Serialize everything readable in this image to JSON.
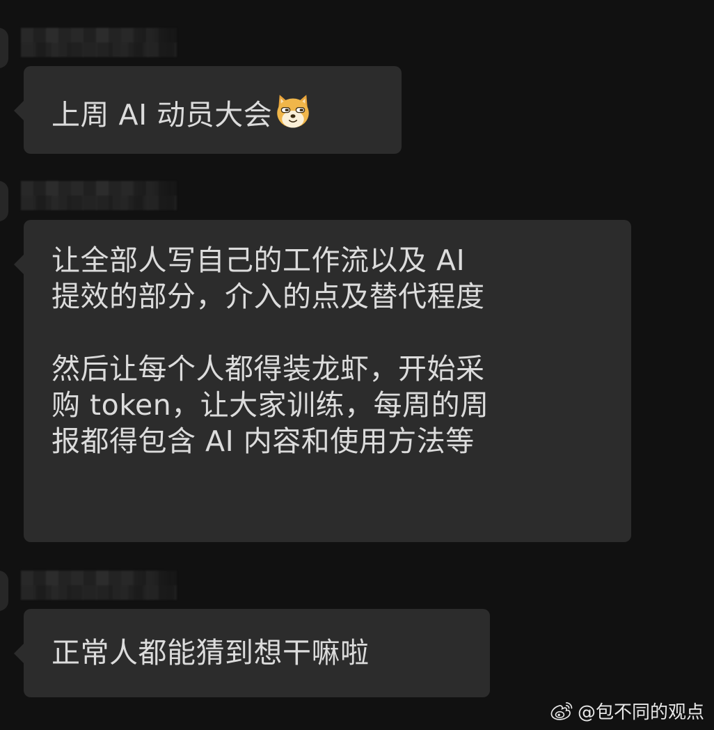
{
  "messages": [
    {
      "sender_name": "",
      "lines": [
        "上周 AI 动员大会"
      ],
      "emoji": "doge-emoji"
    },
    {
      "sender_name": "",
      "paragraphs": [
        [
          "让全部人写自己的工作流以及 AI",
          "提效的部分，介入的点及替代程度"
        ],
        [
          "然后让每个人都得装龙虾，开始采",
          "购 token，让大家训练，每周的周",
          "报都得包含 AI 内容和使用方法等"
        ]
      ]
    },
    {
      "sender_name": "",
      "lines": [
        "正常人都能猜到想干嘛啦"
      ]
    }
  ],
  "watermark": {
    "icon": "weibo-icon",
    "text": "@包不同的观点"
  },
  "colors": {
    "background": "#111111",
    "bubble": "#2c2c2c",
    "text": "#dcdcdc"
  }
}
